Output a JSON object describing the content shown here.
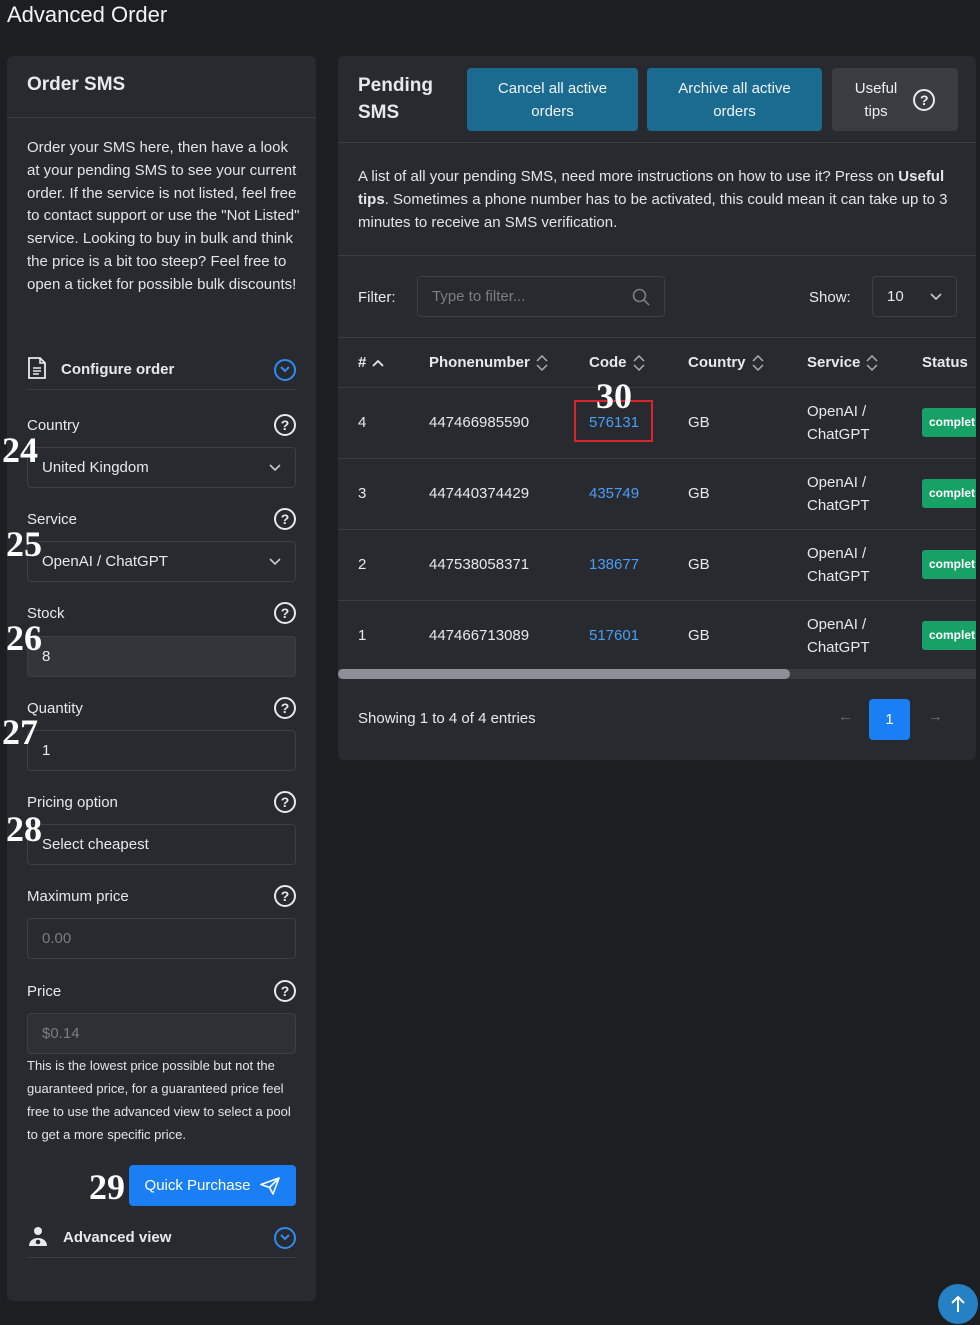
{
  "page_title": "Advanced Order",
  "order_card": {
    "title": "Order SMS",
    "intro": "Order your SMS here, then have a look at your pending SMS to see your current order. If the service is not listed, feel free to contact support or use the \"Not Listed\" service. Looking to buy in bulk and think the price is a bit too steep? Feel free to open a ticket for possible bulk discounts!",
    "configure_label": "Configure order",
    "fields": {
      "country": {
        "label": "Country",
        "value": "United Kingdom",
        "tag": "24"
      },
      "service": {
        "label": "Service",
        "value": "OpenAI / ChatGPT",
        "tag": "25"
      },
      "stock": {
        "label": "Stock",
        "value": "8",
        "tag": "26"
      },
      "quantity": {
        "label": "Quantity",
        "value": "1",
        "tag": "27"
      },
      "pricing": {
        "label": "Pricing option",
        "value": "Select cheapest",
        "tag": "28"
      },
      "max_price": {
        "label": "Maximum price",
        "placeholder": "0.00"
      },
      "price": {
        "label": "Price",
        "value": "$0.14"
      }
    },
    "price_note": "This is the lowest price possible but not the guaranteed price, for a guaranteed price feel free to use the advanced view to select a pool to get a more specific price.",
    "quick_purchase": {
      "label": "Quick Purchase",
      "tag": "29"
    },
    "advanced_label": "Advanced view"
  },
  "pending_card": {
    "title_line1": "Pending",
    "title_line2": "SMS",
    "cancel_btn_line1": "Cancel all active",
    "cancel_btn_line2": "orders",
    "archive_btn_line1": "Archive all active",
    "archive_btn_line2": "orders",
    "tips_btn_line1": "Useful",
    "tips_btn_line2": "tips",
    "desc_part1": "A list of all your pending SMS, need more instructions on how to use it? Press on ",
    "desc_bold1": "Useful tips",
    "desc_part2": ". Sometimes a phone number has to be activated, this could mean it can take up to 3 minutes to receive an SMS verification.",
    "filter_label": "Filter:",
    "filter_placeholder": "Type to filter...",
    "show_label": "Show:",
    "show_value": "10",
    "columns": [
      "#",
      "Phonenumber",
      "Code",
      "Country",
      "Service",
      "Status"
    ],
    "rows": [
      {
        "id": "4",
        "phone": "447466985590",
        "code": "576131",
        "country": "GB",
        "service_l1": "OpenAI /",
        "service_l2": "ChatGPT",
        "status": "complet"
      },
      {
        "id": "3",
        "phone": "447440374429",
        "code": "435749",
        "country": "GB",
        "service_l1": "OpenAI /",
        "service_l2": "ChatGPT",
        "status": "complet"
      },
      {
        "id": "2",
        "phone": "447538058371",
        "code": "138677",
        "country": "GB",
        "service_l1": "OpenAI /",
        "service_l2": "ChatGPT",
        "status": "complet"
      },
      {
        "id": "1",
        "phone": "447466713089",
        "code": "517601",
        "country": "GB",
        "service_l1": "OpenAI /",
        "service_l2": "ChatGPT",
        "status": "complet"
      }
    ],
    "highlight_tag": "30",
    "showing_text": "Showing 1 to 4 of 4 entries",
    "pagination": {
      "prev": "←",
      "current": "1",
      "next": "→"
    }
  },
  "colors": {
    "accent": "#1a7ff5",
    "teal": "#1b6b91",
    "success": "#17a166",
    "highlight": "#d9262c"
  }
}
